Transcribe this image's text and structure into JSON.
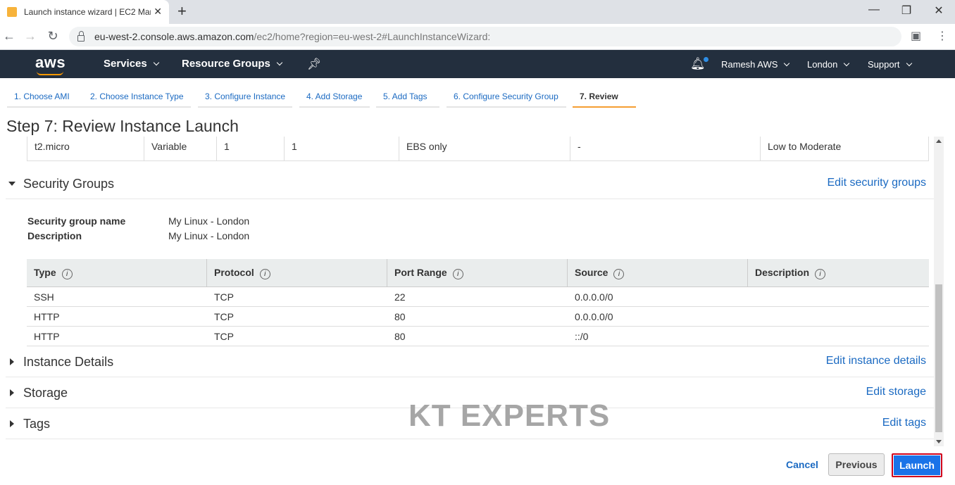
{
  "browser": {
    "tab_title": "Launch instance wizard | EC2 Management Console",
    "url_host": "eu-west-2.console.aws.amazon.com",
    "url_path": "/ec2/home?region=eu-west-2#LaunchInstanceWizard:"
  },
  "aws_header": {
    "logo": "aws",
    "services": "Services",
    "resource_groups": "Resource Groups",
    "user": "Ramesh AWS",
    "region": "London",
    "support": "Support"
  },
  "steps": [
    {
      "label": "1. Choose AMI"
    },
    {
      "label": "2. Choose Instance Type"
    },
    {
      "label": "3. Configure Instance"
    },
    {
      "label": "4. Add Storage"
    },
    {
      "label": "5. Add Tags"
    },
    {
      "label": "6. Configure Security Group"
    },
    {
      "label": "7. Review"
    }
  ],
  "page_title": "Step 7: Review Instance Launch",
  "instance_type_row": [
    "t2.micro",
    "Variable",
    "1",
    "1",
    "EBS only",
    "-",
    "Low to Moderate"
  ],
  "security_groups": {
    "title": "Security Groups",
    "edit": "Edit security groups",
    "name_label": "Security group name",
    "name_value": "My Linux - London",
    "desc_label": "Description",
    "desc_value": "My Linux - London",
    "columns": [
      "Type",
      "Protocol",
      "Port Range",
      "Source",
      "Description"
    ],
    "rows": [
      [
        "SSH",
        "TCP",
        "22",
        "0.0.0.0/0",
        ""
      ],
      [
        "HTTP",
        "TCP",
        "80",
        "0.0.0.0/0",
        ""
      ],
      [
        "HTTP",
        "TCP",
        "80",
        "::/0",
        ""
      ]
    ]
  },
  "sections": {
    "instance_details": {
      "title": "Instance Details",
      "edit": "Edit instance details"
    },
    "storage": {
      "title": "Storage",
      "edit": "Edit storage"
    },
    "tags": {
      "title": "Tags",
      "edit": "Edit tags"
    }
  },
  "watermark": "KT EXPERTS",
  "footer": {
    "cancel": "Cancel",
    "previous": "Previous",
    "launch": "Launch"
  }
}
